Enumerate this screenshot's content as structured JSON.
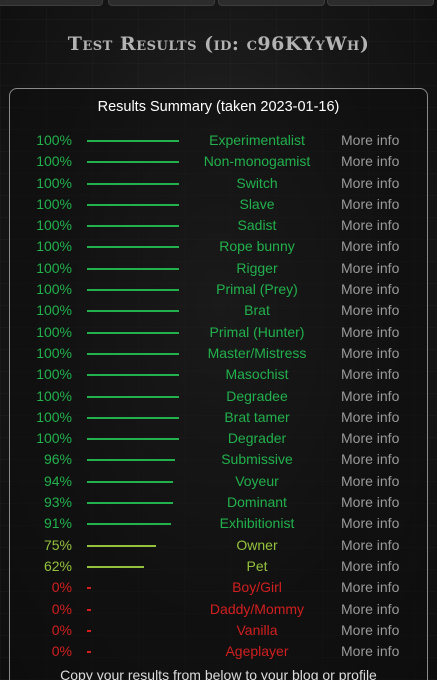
{
  "header": {
    "title": "Test Results (id: c96KYyWh)"
  },
  "summary": {
    "title": "Results Summary (taken 2023-01-16)",
    "more_label": "More info"
  },
  "colors": {
    "high": "#22b14c",
    "mid": "#95c23d",
    "low": "#d31f1f"
  },
  "results": [
    {
      "percent": "100%",
      "value": 100,
      "role": "Experimentalist",
      "level": "high"
    },
    {
      "percent": "100%",
      "value": 100,
      "role": "Non-monogamist",
      "level": "high"
    },
    {
      "percent": "100%",
      "value": 100,
      "role": "Switch",
      "level": "high"
    },
    {
      "percent": "100%",
      "value": 100,
      "role": "Slave",
      "level": "high"
    },
    {
      "percent": "100%",
      "value": 100,
      "role": "Sadist",
      "level": "high"
    },
    {
      "percent": "100%",
      "value": 100,
      "role": "Rope bunny",
      "level": "high"
    },
    {
      "percent": "100%",
      "value": 100,
      "role": "Rigger",
      "level": "high"
    },
    {
      "percent": "100%",
      "value": 100,
      "role": "Primal (Prey)",
      "level": "high"
    },
    {
      "percent": "100%",
      "value": 100,
      "role": "Brat",
      "level": "high"
    },
    {
      "percent": "100%",
      "value": 100,
      "role": "Primal (Hunter)",
      "level": "high"
    },
    {
      "percent": "100%",
      "value": 100,
      "role": "Master/Mistress",
      "level": "high"
    },
    {
      "percent": "100%",
      "value": 100,
      "role": "Masochist",
      "level": "high"
    },
    {
      "percent": "100%",
      "value": 100,
      "role": "Degradee",
      "level": "high"
    },
    {
      "percent": "100%",
      "value": 100,
      "role": "Brat tamer",
      "level": "high"
    },
    {
      "percent": "100%",
      "value": 100,
      "role": "Degrader",
      "level": "high"
    },
    {
      "percent": "96%",
      "value": 96,
      "role": "Submissive",
      "level": "high"
    },
    {
      "percent": "94%",
      "value": 94,
      "role": "Voyeur",
      "level": "high"
    },
    {
      "percent": "93%",
      "value": 93,
      "role": "Dominant",
      "level": "high"
    },
    {
      "percent": "91%",
      "value": 91,
      "role": "Exhibitionist",
      "level": "high"
    },
    {
      "percent": "75%",
      "value": 75,
      "role": "Owner",
      "level": "mid"
    },
    {
      "percent": "62%",
      "value": 62,
      "role": "Pet",
      "level": "mid"
    },
    {
      "percent": "0%",
      "value": 0,
      "role": "Boy/Girl",
      "level": "low"
    },
    {
      "percent": "0%",
      "value": 0,
      "role": "Daddy/Mommy",
      "level": "low"
    },
    {
      "percent": "0%",
      "value": 0,
      "role": "Vanilla",
      "level": "low"
    },
    {
      "percent": "0%",
      "value": 0,
      "role": "Ageplayer",
      "level": "low"
    }
  ],
  "footer": {
    "text": "Copy your results from below to your blog or profile"
  }
}
